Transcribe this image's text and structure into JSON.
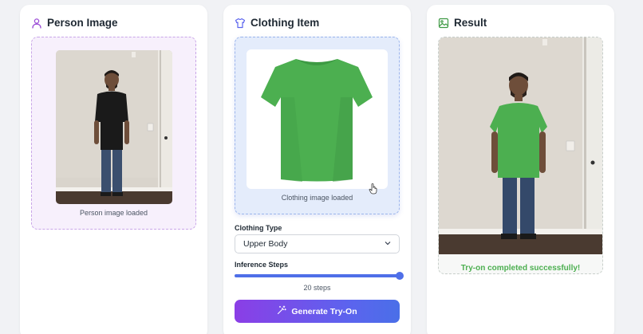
{
  "person_panel": {
    "title": "Person Image",
    "icon": "user-icon",
    "status": "Person image loaded"
  },
  "clothing_panel": {
    "title": "Clothing Item",
    "icon": "shirt-icon",
    "status": "Clothing image loaded",
    "clothing_type_label": "Clothing Type",
    "clothing_type_value": "Upper Body",
    "inference_steps_label": "Inference Steps",
    "inference_steps_value": "20 steps",
    "inference_steps_level": 1.0,
    "generate_button_label": "Generate Try-On",
    "generate_button_icon": "magic-wand-icon"
  },
  "result_panel": {
    "title": "Result",
    "icon": "image-icon",
    "status": "Try-on completed successfully!"
  },
  "colors": {
    "accent_purple": "#8b3ee6",
    "accent_blue": "#4f6fe8",
    "success_green": "#4caf50",
    "shirt_green": "#4caf50"
  }
}
